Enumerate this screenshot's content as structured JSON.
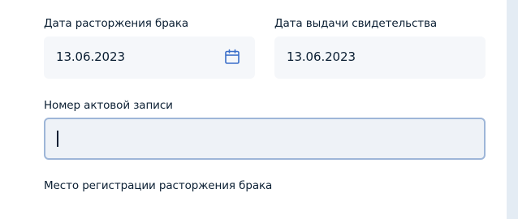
{
  "form": {
    "divorce_date": {
      "label": "Дата расторжения брака",
      "value": "13.06.2023",
      "icon": "calendar-icon"
    },
    "certificate_date": {
      "label": "Дата выдачи свидетельства",
      "value": "13.06.2023"
    },
    "record_number": {
      "label": "Номер актовой записи",
      "value": ""
    },
    "registration_place": {
      "label": "Место регистрации расторжения брака"
    }
  },
  "colors": {
    "page_background": "#e4ecf4",
    "field_background": "#f5f7fa",
    "focus_border": "#9eb6d8",
    "icon_color": "#3b6fc9",
    "text": "#0b1f33"
  }
}
